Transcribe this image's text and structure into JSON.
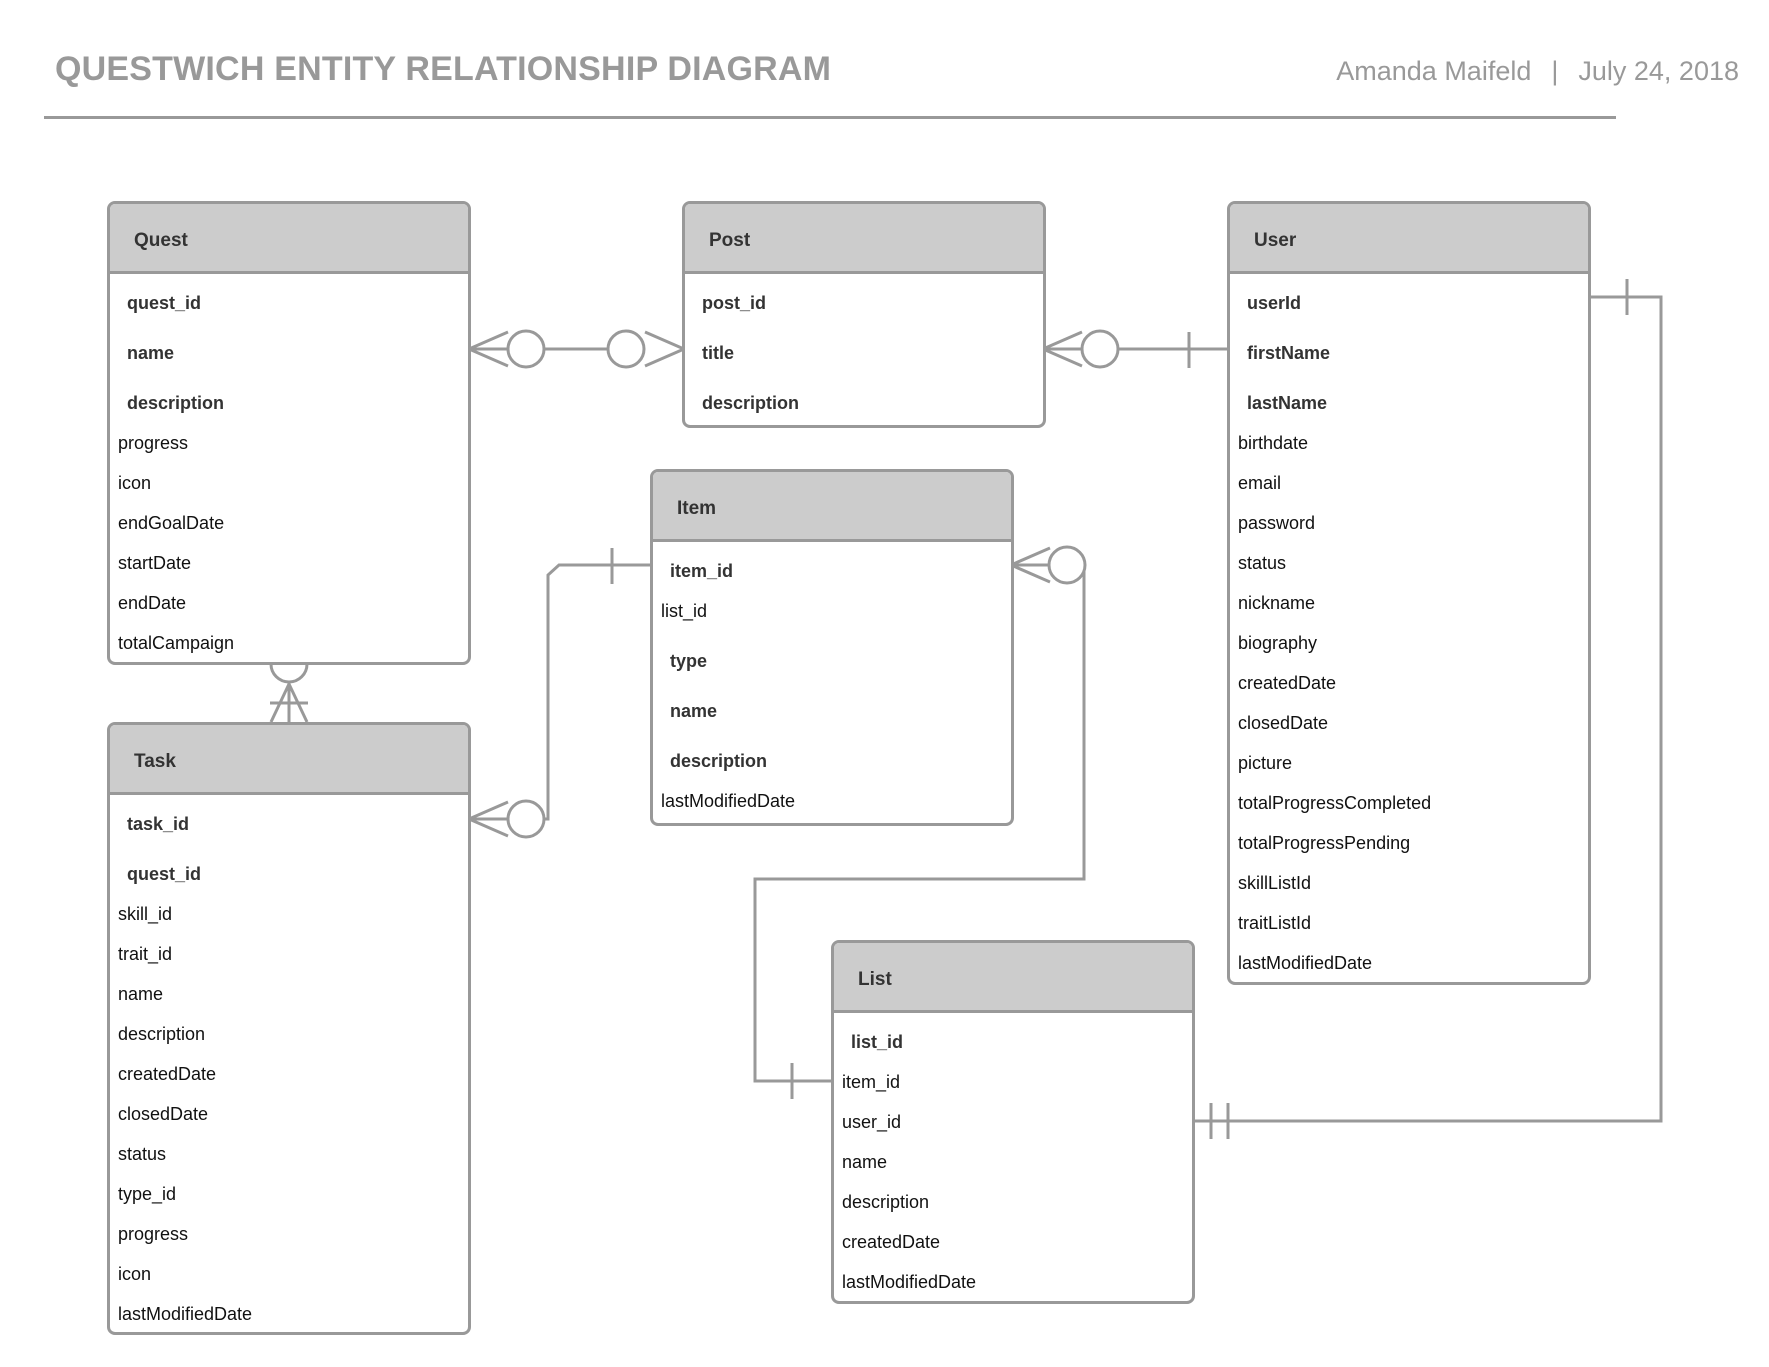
{
  "header": {
    "title": "QUESTWICH ENTITY RELATIONSHIP DIAGRAM",
    "author": "Amanda Maifeld",
    "separator": "|",
    "date": "July 24, 2018"
  },
  "colors": {
    "line": "#999999",
    "header_fill": "#cccccc",
    "title_text": "#999999",
    "attr_text": "#111111"
  },
  "entities": {
    "quest": {
      "name": "Quest",
      "keys": [
        "quest_id",
        "name",
        "description"
      ],
      "attributes": [
        "progress",
        "icon",
        "endGoalDate",
        "startDate",
        "endDate",
        "totalCampaign"
      ]
    },
    "post": {
      "name": "Post",
      "keys": [
        "post_id",
        "title",
        "description"
      ],
      "attributes": []
    },
    "user": {
      "name": "User",
      "keys": [
        "userId",
        "firstName",
        "lastName"
      ],
      "attributes": [
        "birthdate",
        "email",
        "password",
        "status",
        "nickname",
        "biography",
        "createdDate",
        "closedDate",
        "picture",
        "totalProgressCompleted",
        "totalProgressPending",
        "skillListId",
        "traitListId",
        "lastModifiedDate"
      ]
    },
    "item": {
      "name": "Item",
      "rows": [
        {
          "text": "item_id",
          "key": true
        },
        {
          "text": "list_id",
          "key": false
        },
        {
          "text": "type",
          "key": true
        },
        {
          "text": "name",
          "key": true
        },
        {
          "text": "description",
          "key": true
        },
        {
          "text": "lastModifiedDate",
          "key": false
        }
      ]
    },
    "task": {
      "name": "Task",
      "keys": [
        "task_id",
        "quest_id"
      ],
      "attributes": [
        "skill_id",
        "trait_id",
        "name",
        "description",
        "createdDate",
        "closedDate",
        "status",
        "type_id",
        "progress",
        "icon",
        "lastModifiedDate"
      ]
    },
    "list": {
      "name": "List",
      "keys": [
        "list_id"
      ],
      "attributes": [
        "item_id",
        "user_id",
        "name",
        "description",
        "createdDate",
        "lastModifiedDate"
      ]
    }
  },
  "relationships": [
    {
      "from": "Quest",
      "to": "Post",
      "from_end": "zero-or-many",
      "to_end": "zero-or-many"
    },
    {
      "from": "Post",
      "to": "User",
      "from_end": "zero-or-many",
      "to_end": "one"
    },
    {
      "from": "Quest",
      "to": "Task",
      "from_end": "zero-or-one",
      "to_end": "one-or-many"
    },
    {
      "from": "Task",
      "to": "Item",
      "from_end": "zero-or-many",
      "to_end": "one"
    },
    {
      "from": "Item",
      "to": "List",
      "from_end": "zero-or-many",
      "to_end": "one"
    },
    {
      "from": "User",
      "to": "List",
      "from_end": "one",
      "to_end": "one-and-only-one"
    }
  ]
}
